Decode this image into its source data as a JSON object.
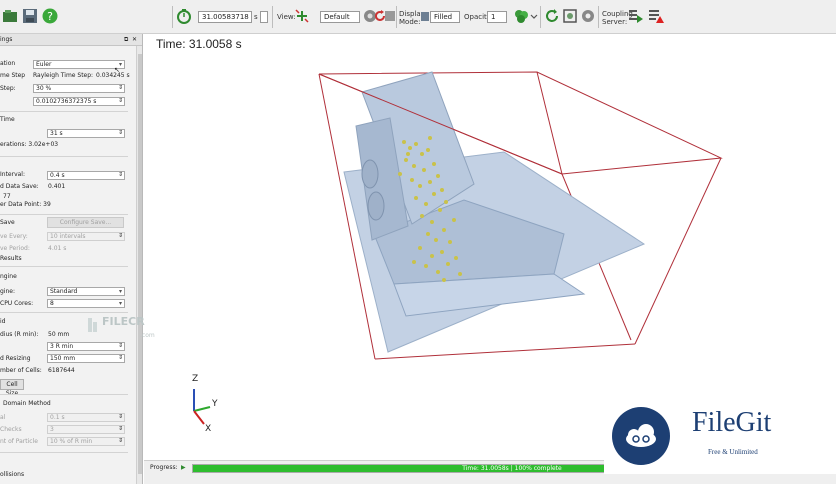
{
  "toolbar": {
    "time_value": "31.00583718",
    "time_unit": "s",
    "view_label": "View:",
    "view_value": "Default",
    "display_mode_label_1": "Display",
    "display_mode_label_2": "Mode:",
    "display_mode_value": "Filled",
    "opacity_label": "Opacity:",
    "opacity_value": "1",
    "coupling_label_1": "Coupling",
    "coupling_label_2": "Server:"
  },
  "panel": {
    "header": "ings",
    "rows": {
      "integration_label": "ation",
      "integration_value": "Euler",
      "time_step_label": "me Step",
      "rayleigh_label": "Rayleigh Time Step:",
      "rayleigh_value": "0.034245 s",
      "fixed_step_label": "Step:",
      "fixed_step_pct": "30 %",
      "fixed_step_s": "0.0102736372375 s",
      "total_time_header": "Time",
      "total_time_value": "31 s",
      "iterations": "erations: 3.02e+03",
      "save_interval_label": "Interval:",
      "save_interval_value": "0.4 s",
      "data_save_label": "d Data Save:",
      "data_save_value": "0.401",
      "count_value": "77",
      "per_data_point": "er Data Point: 39",
      "autosave_header": "Save",
      "configure_save": "Configure Save...",
      "save_every_label": "ve Every:",
      "save_every_value": "10 intervals",
      "save_period_label": "ve Period:",
      "save_period_value": "4.01 s",
      "results_header": "Results",
      "engine_header": "ngine",
      "engine_label": "gine:",
      "engine_value": "Standard",
      "cpu_label": "CPU Cores:",
      "cpu_value": "8",
      "grid_header": "id",
      "radius_label": "dius (R min):",
      "radius_value": "50 mm",
      "grid_cell_value": "3 R min",
      "resizing_label": "d Resizing",
      "resizing_value": "150 mm",
      "cells_label": "mber of Cells:",
      "cells_value": "6187644",
      "cell_size_button": "Cell Size",
      "domain_header": "Domain Method",
      "domain1_label": "al",
      "domain1_value": "0.1 s",
      "domain2_label": "Checks",
      "domain2_value": "3",
      "domain3_label": "nt of Particle",
      "domain3_value": "10 % of R min",
      "collisions_header": "ollisions"
    }
  },
  "viewport": {
    "sim_time": "Time: 31.0058 s",
    "axes": {
      "z": "Z",
      "y": "Y",
      "x": "X"
    }
  },
  "progress": {
    "label": "Progress:",
    "fraction": 0.985,
    "text": "Time: 31.0058s | 100% complete"
  },
  "watermarks": {
    "filecr": "FILECR",
    "filecr_sub": ".com",
    "filegit": "FileGit",
    "filegit_sub": "Free & Unlimited"
  },
  "colors": {
    "progress_green": "#2ebd2e",
    "domain_box": "#b0303a",
    "geometry": "#b7c8de",
    "particles": "#c9c24a"
  }
}
